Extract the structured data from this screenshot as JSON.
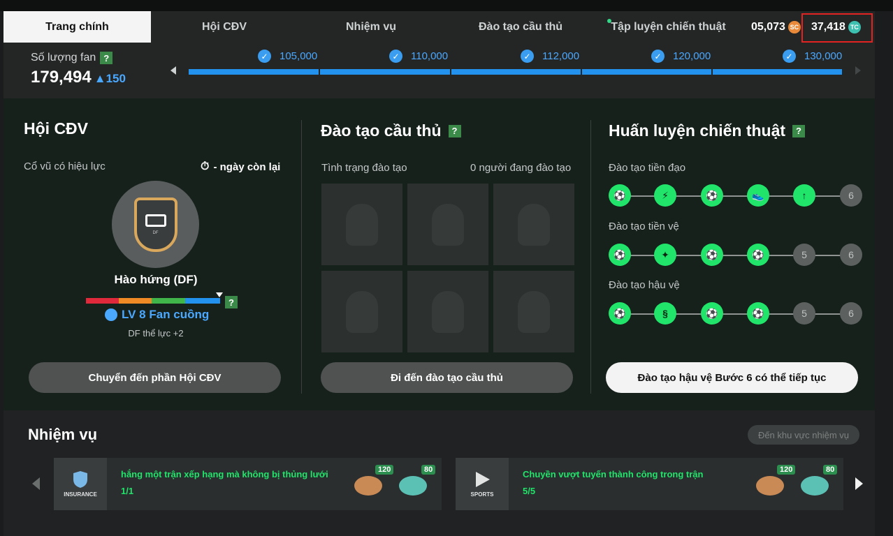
{
  "nav": {
    "tabs": [
      {
        "label": "Trang chính"
      },
      {
        "label": "Hội CĐV"
      },
      {
        "label": "Nhiệm vụ"
      },
      {
        "label": "Đào tạo cầu thủ"
      },
      {
        "label": "Tập luyện chiến thuật"
      }
    ],
    "sc_amount": "05,073",
    "sc_icon": "SC",
    "tc_amount": "37,418",
    "tc_icon": "TC"
  },
  "fans": {
    "label": "Số lượng fan",
    "value": "179,494",
    "delta": "▲150",
    "milestones": [
      "105,000",
      "110,000",
      "112,000",
      "120,000",
      "130,000"
    ]
  },
  "club": {
    "title": "Hội CĐV",
    "buff_label": "Cổ vũ có hiệu lực",
    "days_left": "- ngày còn lại",
    "badge_text": "DF",
    "status": "Hào hứng (DF)",
    "level": "LV 8 Fan cuồng",
    "bonus": "DF thể lực +2",
    "button": "Chuyển đến phần Hội CĐV",
    "bar_colors": [
      "#e02a3b",
      "#f08a24",
      "#3fb54a",
      "#2392ee"
    ]
  },
  "training": {
    "title": "Đào tạo cầu thủ",
    "status_label": "Tình trạng đào tạo",
    "count_label": "0 người đang đào tạo",
    "button": "Đi đến đào tạo cầu thủ"
  },
  "tactics": {
    "title": "Huấn luyện chiến thuật",
    "rows": [
      {
        "label": "Đào tạo tiền đạo",
        "steps": [
          "",
          "",
          "",
          "",
          "",
          "6"
        ],
        "done": 5
      },
      {
        "label": "Đào tạo tiền vệ",
        "steps": [
          "",
          "",
          "",
          "",
          "5",
          "6"
        ],
        "done": 4
      },
      {
        "label": "Đào tạo hậu vệ",
        "steps": [
          "",
          "",
          "",
          "",
          "5",
          "6"
        ],
        "done": 4
      }
    ],
    "button": "Đào tạo hậu vệ Bước 6 có thể tiếp tục"
  },
  "missions": {
    "title": "Nhiệm vụ",
    "goto": "Đến khu vực nhiệm vụ",
    "cards": [
      {
        "logo": "INSURANCE",
        "text": "hắng một trận xếp hạng mà không bị thủng lưới",
        "progress": "1/1",
        "sc": "120",
        "tc": "80"
      },
      {
        "logo": "SPORTS",
        "text": "Chuyền vượt tuyến thành công trong trận",
        "progress": "5/5",
        "sc": "120",
        "tc": "80"
      }
    ]
  },
  "help": "?"
}
